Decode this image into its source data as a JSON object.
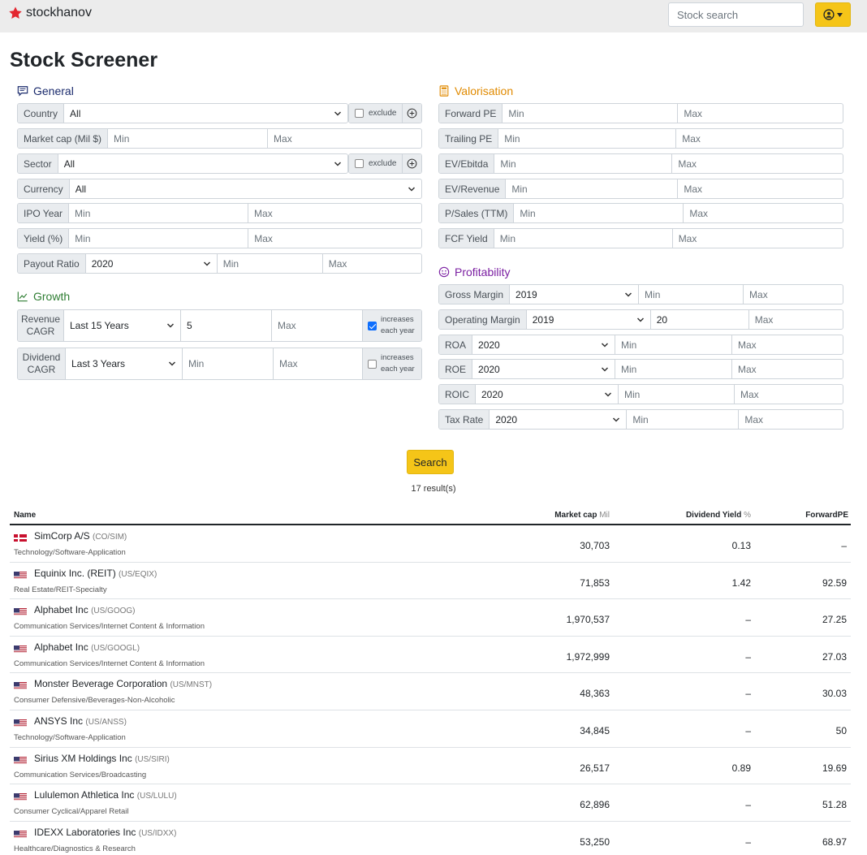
{
  "app": {
    "title": "stockhanov",
    "search_placeholder": "Stock search"
  },
  "page_title": "Stock Screener",
  "general": {
    "title": "General",
    "country": {
      "label": "Country",
      "value": "All",
      "exclude": "exclude"
    },
    "market_cap": {
      "label": "Market cap (Mil $)",
      "min": "Min",
      "max": "Max"
    },
    "sector": {
      "label": "Sector",
      "value": "All",
      "exclude": "exclude"
    },
    "currency": {
      "label": "Currency",
      "value": "All"
    },
    "ipo_year": {
      "label": "IPO Year",
      "min": "Min",
      "max": "Max"
    },
    "yield": {
      "label": "Yield (%)",
      "min": "Min",
      "max": "Max"
    },
    "payout": {
      "label": "Payout Ratio",
      "year": "2020",
      "min": "Min",
      "max": "Max"
    }
  },
  "growth": {
    "title": "Growth",
    "revenue": {
      "label1": "Revenue",
      "label2": "CAGR",
      "period": "Last 15 Years",
      "min": "5",
      "max": "Max",
      "note1": "increases",
      "note2": "each year",
      "checked": true
    },
    "dividend": {
      "label1": "Dividend",
      "label2": "CAGR",
      "period": "Last 3 Years",
      "min": "Min",
      "max": "Max",
      "note1": "increases",
      "note2": "each year",
      "checked": false
    }
  },
  "valorisation": {
    "title": "Valorisation",
    "forward_pe": {
      "label": "Forward PE",
      "min": "Min",
      "max": "Max"
    },
    "trailing_pe": {
      "label": "Trailing PE",
      "min": "Min",
      "max": "Max"
    },
    "ev_ebitda": {
      "label": "EV/Ebitda",
      "min": "Min",
      "max": "Max"
    },
    "ev_revenue": {
      "label": "EV/Revenue",
      "min": "Min",
      "max": "Max"
    },
    "p_sales": {
      "label": "P/Sales (TTM)",
      "min": "Min",
      "max": "Max"
    },
    "fcf_yield": {
      "label": "FCF Yield",
      "min": "Min",
      "max": "Max"
    }
  },
  "profitability": {
    "title": "Profitability",
    "gross_margin": {
      "label": "Gross Margin",
      "year": "2019",
      "min": "Min",
      "max": "Max"
    },
    "operating_margin": {
      "label": "Operating Margin",
      "year": "2019",
      "min": "20",
      "max": "Max"
    },
    "roa": {
      "label": "ROA",
      "year": "2020",
      "min": "Min",
      "max": "Max"
    },
    "roe": {
      "label": "ROE",
      "year": "2020",
      "min": "Min",
      "max": "Max"
    },
    "roic": {
      "label": "ROIC",
      "year": "2020",
      "min": "Min",
      "max": "Max"
    },
    "tax_rate": {
      "label": "Tax Rate",
      "year": "2020",
      "min": "Min",
      "max": "Max"
    }
  },
  "search_button": "Search",
  "results_text": "17 result(s)",
  "table": {
    "headers": {
      "name": "Name",
      "mcap": "Market cap",
      "mcap_unit": "Mil",
      "dy": "Dividend Yield",
      "dy_unit": "%",
      "fpe": "ForwardPE"
    },
    "rows": [
      {
        "name": "SimCorp A/S",
        "ticker": "(CO/SIM)",
        "category": "Technology/Software-Application",
        "mcap": "30,703",
        "dy": "0.13",
        "fpe": "–",
        "flag": "dk"
      },
      {
        "name": "Equinix Inc. (REIT)",
        "ticker": "(US/EQIX)",
        "category": "Real Estate/REIT-Specialty",
        "mcap": "71,853",
        "dy": "1.42",
        "fpe": "92.59",
        "flag": "us"
      },
      {
        "name": "Alphabet Inc",
        "ticker": "(US/GOOG)",
        "category": "Communication Services/Internet Content & Information",
        "mcap": "1,970,537",
        "dy": "–",
        "fpe": "27.25",
        "flag": "us"
      },
      {
        "name": "Alphabet Inc",
        "ticker": "(US/GOOGL)",
        "category": "Communication Services/Internet Content & Information",
        "mcap": "1,972,999",
        "dy": "–",
        "fpe": "27.03",
        "flag": "us"
      },
      {
        "name": "Monster Beverage Corporation",
        "ticker": "(US/MNST)",
        "category": "Consumer Defensive/Beverages-Non-Alcoholic",
        "mcap": "48,363",
        "dy": "–",
        "fpe": "30.03",
        "flag": "us"
      },
      {
        "name": "ANSYS Inc",
        "ticker": "(US/ANSS)",
        "category": "Technology/Software-Application",
        "mcap": "34,845",
        "dy": "–",
        "fpe": "50",
        "flag": "us"
      },
      {
        "name": "Sirius XM Holdings Inc",
        "ticker": "(US/SIRI)",
        "category": "Communication Services/Broadcasting",
        "mcap": "26,517",
        "dy": "0.89",
        "fpe": "19.69",
        "flag": "us"
      },
      {
        "name": "Lululemon Athletica Inc",
        "ticker": "(US/LULU)",
        "category": "Consumer Cyclical/Apparel Retail",
        "mcap": "62,896",
        "dy": "–",
        "fpe": "51.28",
        "flag": "us"
      },
      {
        "name": "IDEXX Laboratories Inc",
        "ticker": "(US/IDXX)",
        "category": "Healthcare/Diagnostics & Research",
        "mcap": "53,250",
        "dy": "–",
        "fpe": "68.97",
        "flag": "us"
      }
    ]
  },
  "colors": {
    "accent": "#f5c518",
    "general": "#1a2a6c",
    "growth": "#2e7d32",
    "valorisation": "#e08a00",
    "profitability": "#7b1fa2",
    "brand_star": "#e3262f"
  }
}
